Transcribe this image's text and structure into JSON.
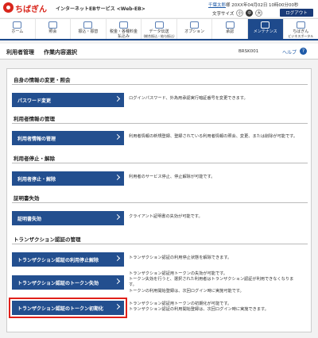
{
  "header": {
    "bank_name": "ちばぎん",
    "service_name": "インターネットEBサービス <Web-EB>",
    "user_name": "千葉太郎",
    "user_suffix": "様",
    "last_login": "20XX年04月02日 10時00分00秒",
    "font_size_label": "文字サイズ",
    "font_sizes": [
      "小",
      "中",
      "大"
    ],
    "active_font_size": "中",
    "logout_label": "ログアウト"
  },
  "nav": {
    "items": [
      {
        "label": "ホーム",
        "sub": "",
        "icon": "home-icon",
        "active": false
      },
      {
        "label": "照会",
        "sub": "",
        "icon": "inquiry-icon",
        "active": false
      },
      {
        "label": "振込・振替",
        "sub": "",
        "icon": "transfer-icon",
        "active": false
      },
      {
        "label": "税金・各種料金",
        "sub": "払込み",
        "icon": "tax-payment-icon",
        "active": false
      },
      {
        "label": "データ伝送",
        "sub": "(総合振込・給与振込)",
        "icon": "data-transfer-icon",
        "active": false
      },
      {
        "label": "オプション",
        "sub": "",
        "icon": "option-icon",
        "active": false
      },
      {
        "label": "承認",
        "sub": "",
        "icon": "approval-icon",
        "active": false
      },
      {
        "label": "メンテナンス",
        "sub": "",
        "icon": "maintenance-icon",
        "active": true
      },
      {
        "label": "ちばぎん",
        "sub": "ビジネスポータル",
        "icon": "portal-icon",
        "active": false
      }
    ]
  },
  "page": {
    "breadcrumb_1": "利用者管理",
    "breadcrumb_2": "作業内容選択",
    "screen_id": "BRSK001",
    "help_label": "ヘルプ",
    "help_icon": "?"
  },
  "sections": [
    {
      "title": "自身の情報の変更・照会",
      "items": [
        {
          "button": "パスワード変更",
          "desc": [
            "ログインパスワード、外為用承認実行暗証番号を変更できます。"
          ]
        }
      ]
    },
    {
      "title": "利用者情報の管理",
      "items": [
        {
          "button": "利用者情報の管理",
          "desc": [
            "利用者情報の新規登録、登録されている利用者情報の照会、変更、または削除が可能です。"
          ]
        }
      ]
    },
    {
      "title": "利用者停止・解除",
      "items": [
        {
          "button": "利用者停止・解除",
          "desc": [
            "利用者のサービス停止、停止解除が可能です。"
          ]
        }
      ]
    },
    {
      "title": "証明書失効",
      "items": [
        {
          "button": "証明書失効",
          "desc": [
            "クライアント証明書の失効が可能です。"
          ]
        }
      ]
    },
    {
      "title": "トランザクション認証の管理",
      "items": [
        {
          "button": "トランザクション認証の利用停止解除",
          "desc": [
            "トランザクション認証の利用停止状態を解除できます。"
          ]
        },
        {
          "button": "トランザクション認証のトークン失効",
          "desc": [
            "トランザクション認証用トークンの失効が可能です。",
            "トークン失効を行うと、選択された利用者はトランザクション認証が利用できなくなりま",
            "す。",
            "トークンの利用開始登録は、次回ログイン時に実施可能です。"
          ]
        },
        {
          "button": "トランザクション認証のトークン初期化",
          "desc": [
            "トランザクション認証用トークンの初期化が可能です。",
            "トランザクション認証の利用開始登録は、次回ログイン時に実施できます。"
          ]
        }
      ]
    }
  ],
  "highlighted_button": "トランザクション認証のトークン初期化",
  "colors": {
    "brand_red": "#d9261c",
    "nav_active": "#1e4a8c",
    "button_blue": "#234f8f",
    "highlight_outline": "#e0201a"
  }
}
